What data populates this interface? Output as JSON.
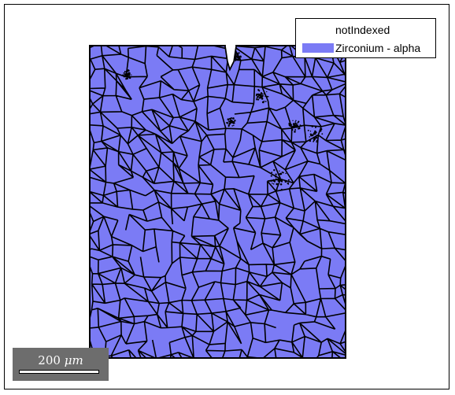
{
  "legend": {
    "items": [
      {
        "label": "notIndexed",
        "color": "#ffffff"
      },
      {
        "label": "Zirconium - alpha",
        "color": "#7b7bf5"
      }
    ]
  },
  "scalebar": {
    "value": "200",
    "unit": "μm"
  },
  "map": {
    "fill_color": "#7b7bf5",
    "boundary_color": "#000000"
  }
}
